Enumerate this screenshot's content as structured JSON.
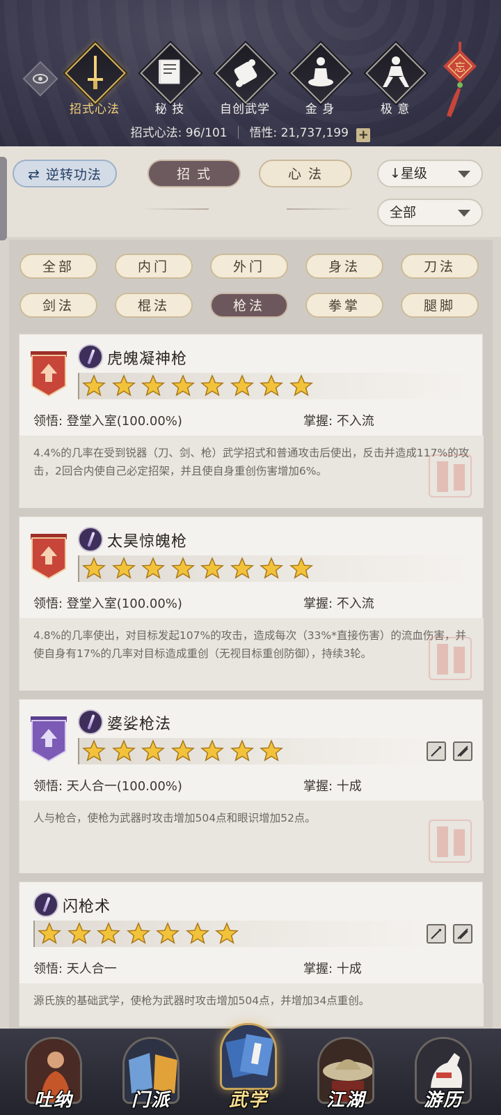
{
  "header": {
    "tabs": [
      {
        "label": "招式心法",
        "icon": "sword-icon",
        "active": true
      },
      {
        "label": "秘 技",
        "icon": "book-icon",
        "active": false
      },
      {
        "label": "自创武学",
        "icon": "scroll-icon",
        "active": false
      },
      {
        "label": "金 身",
        "icon": "meditation-icon",
        "active": false
      },
      {
        "label": "极 意",
        "icon": "martial-stance-icon",
        "active": false
      }
    ],
    "knot_char": "忘",
    "stats": {
      "moves_label": "招式心法: 96/101",
      "insight_label": "悟性: 21,737,199",
      "plus": "+"
    }
  },
  "controls": {
    "reverse_label": "逆转功法",
    "tab_moves": "招 式",
    "tab_mind": "心 法",
    "sort_label": "星级",
    "filter_label": "全部"
  },
  "filters": [
    "全部",
    "内门",
    "外门",
    "身法",
    "刀法",
    "剑法",
    "棍法",
    "枪法",
    "拳掌",
    "腿脚"
  ],
  "active_filter": "枪法",
  "skills": [
    {
      "name": "虎魄凝神枪",
      "stars": 8,
      "rank_color": "red",
      "comprehension": "领悟:  登堂入室(100.00%)",
      "mastery": "掌握:  不入流",
      "description": "4.4%的几率在受到锐器（刀、剑、枪）武学招式和普通攻击后使出，反击并造成117%的攻击，2回合内使自己必定招架，并且使自身重创伤害增加6%。"
    },
    {
      "name": "太昊惊魄枪",
      "stars": 8,
      "rank_color": "red",
      "comprehension": "领悟:  登堂入室(100.00%)",
      "mastery": "掌握:  不入流",
      "description": "4.8%的几率使出，对目标发起107%的攻击，造成每次（33%*直接伤害）的流血伤害，并使自身有17%的几率对目标造成重创（无视目标重创防御），持续3轮。"
    },
    {
      "name": "婆娑枪法",
      "stars": 7,
      "rank_color": "purple",
      "comprehension": "领悟:  天人合一(100.00%)",
      "mastery": "掌握:  十成",
      "description": "人与枪合，使枪为武器时攻击增加504点和眼识增加52点。"
    },
    {
      "name": "闪枪术",
      "stars": 7,
      "rank_color": "none",
      "comprehension": "领悟:  天人合一",
      "mastery": "掌握:  十成",
      "description": "源氏族的基础武学，使枪为武器时攻击增加504点，并增加34点重创。"
    }
  ],
  "bottom_nav": [
    {
      "label": "吐纳",
      "active": false
    },
    {
      "label": "门派",
      "active": false
    },
    {
      "label": "武学",
      "active": true
    },
    {
      "label": "江湖",
      "active": false
    },
    {
      "label": "游历",
      "active": false
    }
  ],
  "colors": {
    "header_bg": "#36354a",
    "active_gold": "#f5d27a",
    "rank_red": "#c8453a",
    "rank_purple": "#7b5bb5",
    "star_gold": "#f2c33a"
  }
}
